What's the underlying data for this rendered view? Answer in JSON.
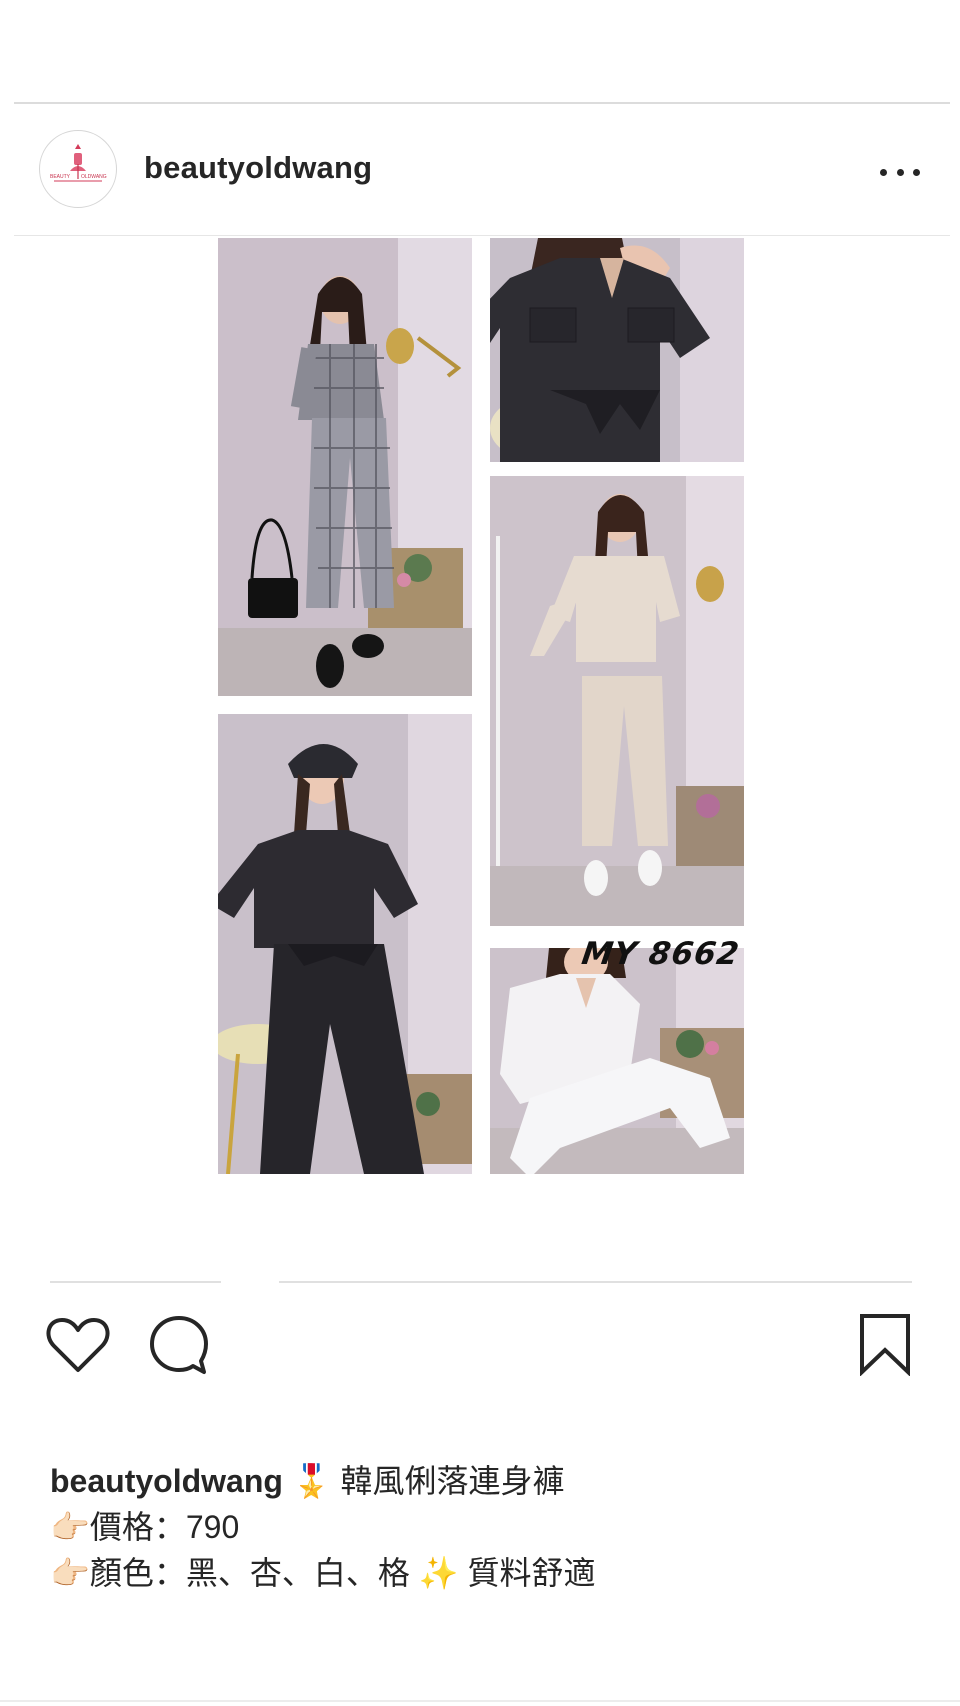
{
  "post": {
    "username": "beautyoldwang",
    "avatar_text_left": "BEAUTY",
    "avatar_text_right": "OLDWANG",
    "more_icon": "more-horizontal-icon"
  },
  "media": {
    "watermark": "MY 8662",
    "tiles": [
      {
        "name": "gingham-jumpsuit-photo"
      },
      {
        "name": "black-jumpsuit-closeup-photo"
      },
      {
        "name": "beige-jumpsuit-photo"
      },
      {
        "name": "black-jumpsuit-cap-photo"
      },
      {
        "name": "white-jumpsuit-photo"
      }
    ]
  },
  "actions": {
    "like_icon": "heart-icon",
    "comment_icon": "comment-icon",
    "save_icon": "bookmark-icon"
  },
  "caption": {
    "username": "beautyoldwang",
    "line1_emoji": "🎖️",
    "line1_text": "韓風俐落連身褲",
    "line2_emoji": "👉🏻",
    "line2_text": "價格：790",
    "line3_emoji": "👉🏻",
    "line3_text": "顏色：黑、杏、白、格",
    "line3_sparkle": "✨",
    "line3_tail": "質料舒適"
  },
  "colors": {
    "text": "#262626",
    "divider": "#e0e0e0",
    "background": "#ffffff"
  }
}
